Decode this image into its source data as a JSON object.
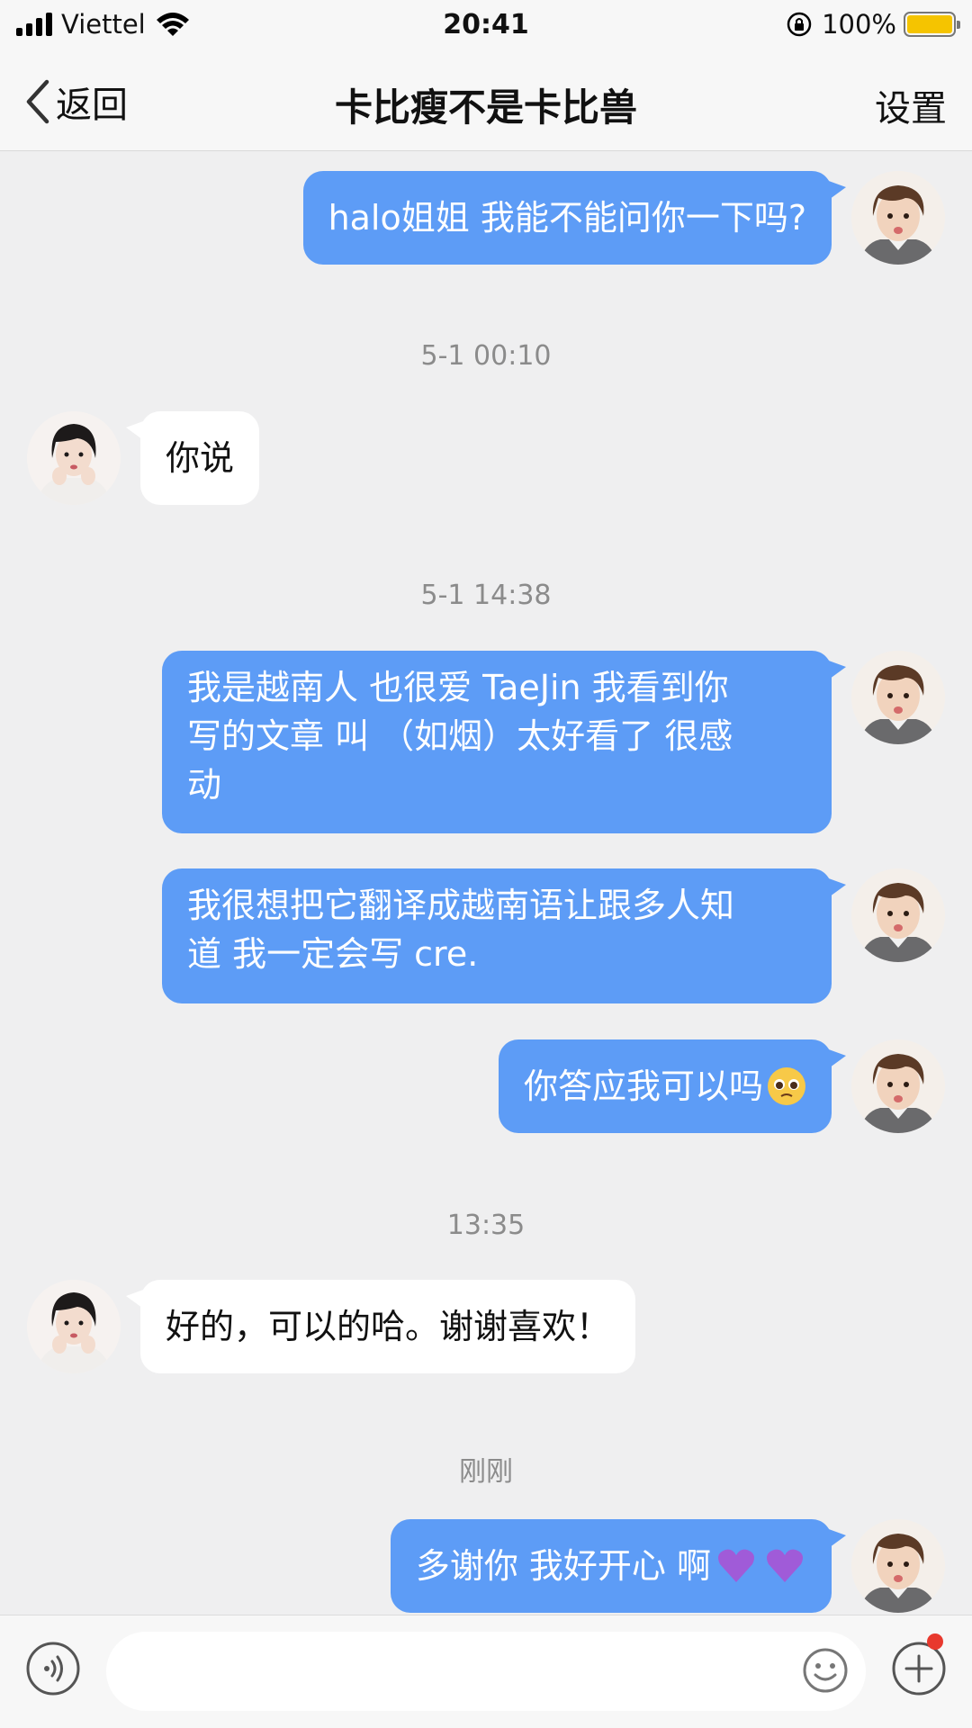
{
  "status_bar": {
    "carrier": "Viettel",
    "time": "20:41",
    "battery_percent": "100%",
    "battery_level": 1.0
  },
  "nav": {
    "back_label": "返回",
    "title": "卡比瘦不是卡比兽",
    "settings_label": "设置"
  },
  "chat": {
    "messages": [
      {
        "text": "halo姐姐 我能不能问你一下吗?"
      },
      {
        "timestamp": "5-1 00:10"
      },
      {
        "text": "你说"
      },
      {
        "timestamp": "5-1 14:38"
      },
      {
        "lines": [
          "我是越南人 也很爱 TaeJin 我看到你",
          "写的文章 叫 （如烟）太好看了 很感",
          "动"
        ]
      },
      {
        "lines": [
          "我很想把它翻译成越南语让跟多人知",
          "道 我一定会写 cre."
        ]
      },
      {
        "text": "你答应我可以吗",
        "emoji": "pleading-face"
      },
      {
        "timestamp": "13:35"
      },
      {
        "text": "好的，可以的哈。谢谢喜欢！"
      },
      {
        "timestamp": "刚刚"
      },
      {
        "text": "多谢你 我好开心 啊",
        "emoji": "purple-heart"
      }
    ]
  },
  "input_bar": {
    "placeholder": "",
    "voice_icon": "voice-icon",
    "emoji_icon": "smiley-icon",
    "plus_icon": "plus-icon",
    "has_notification": true
  },
  "colors": {
    "outgoing_bubble": "#5d9cf6",
    "incoming_bubble": "#ffffff",
    "background": "#efeff0",
    "notification_dot": "#e8392e",
    "battery": "#f5c400"
  }
}
